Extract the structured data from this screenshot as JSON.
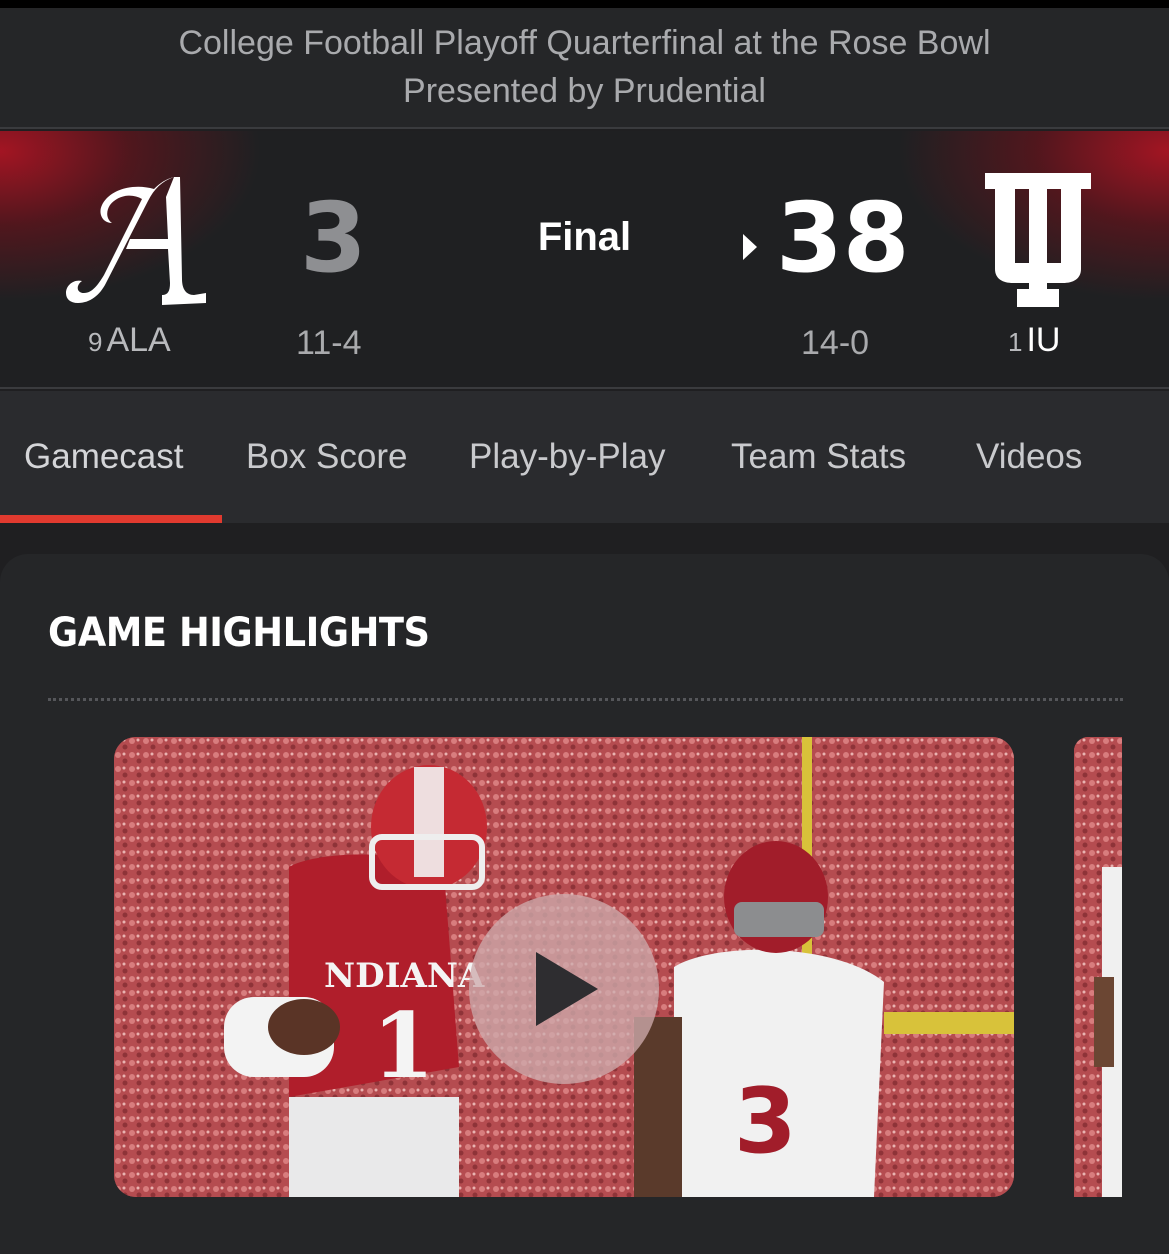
{
  "event": {
    "line1": "College Football Playoff Quarterfinal at the Rose Bowl",
    "line2": "Presented by Prudential"
  },
  "game": {
    "status": "Final",
    "away": {
      "rank": "9",
      "abbr": "ALA",
      "score": "3",
      "record": "11-4",
      "logo_icon": "alabama-script-a-logo"
    },
    "home": {
      "rank": "1",
      "abbr": "IU",
      "score": "38",
      "record": "14-0",
      "logo_icon": "indiana-trident-logo",
      "winner": true
    }
  },
  "tabs": [
    {
      "label": "Gamecast",
      "active": true
    },
    {
      "label": "Box Score"
    },
    {
      "label": "Play-by-Play"
    },
    {
      "label": "Team Stats"
    },
    {
      "label": "Videos"
    }
  ],
  "highlights": {
    "title": "GAME HIGHLIGHTS"
  },
  "colors": {
    "accent": "#e03a2f",
    "crimson": "#a8141f",
    "background": "#1f1f21",
    "panel": "#252628"
  }
}
